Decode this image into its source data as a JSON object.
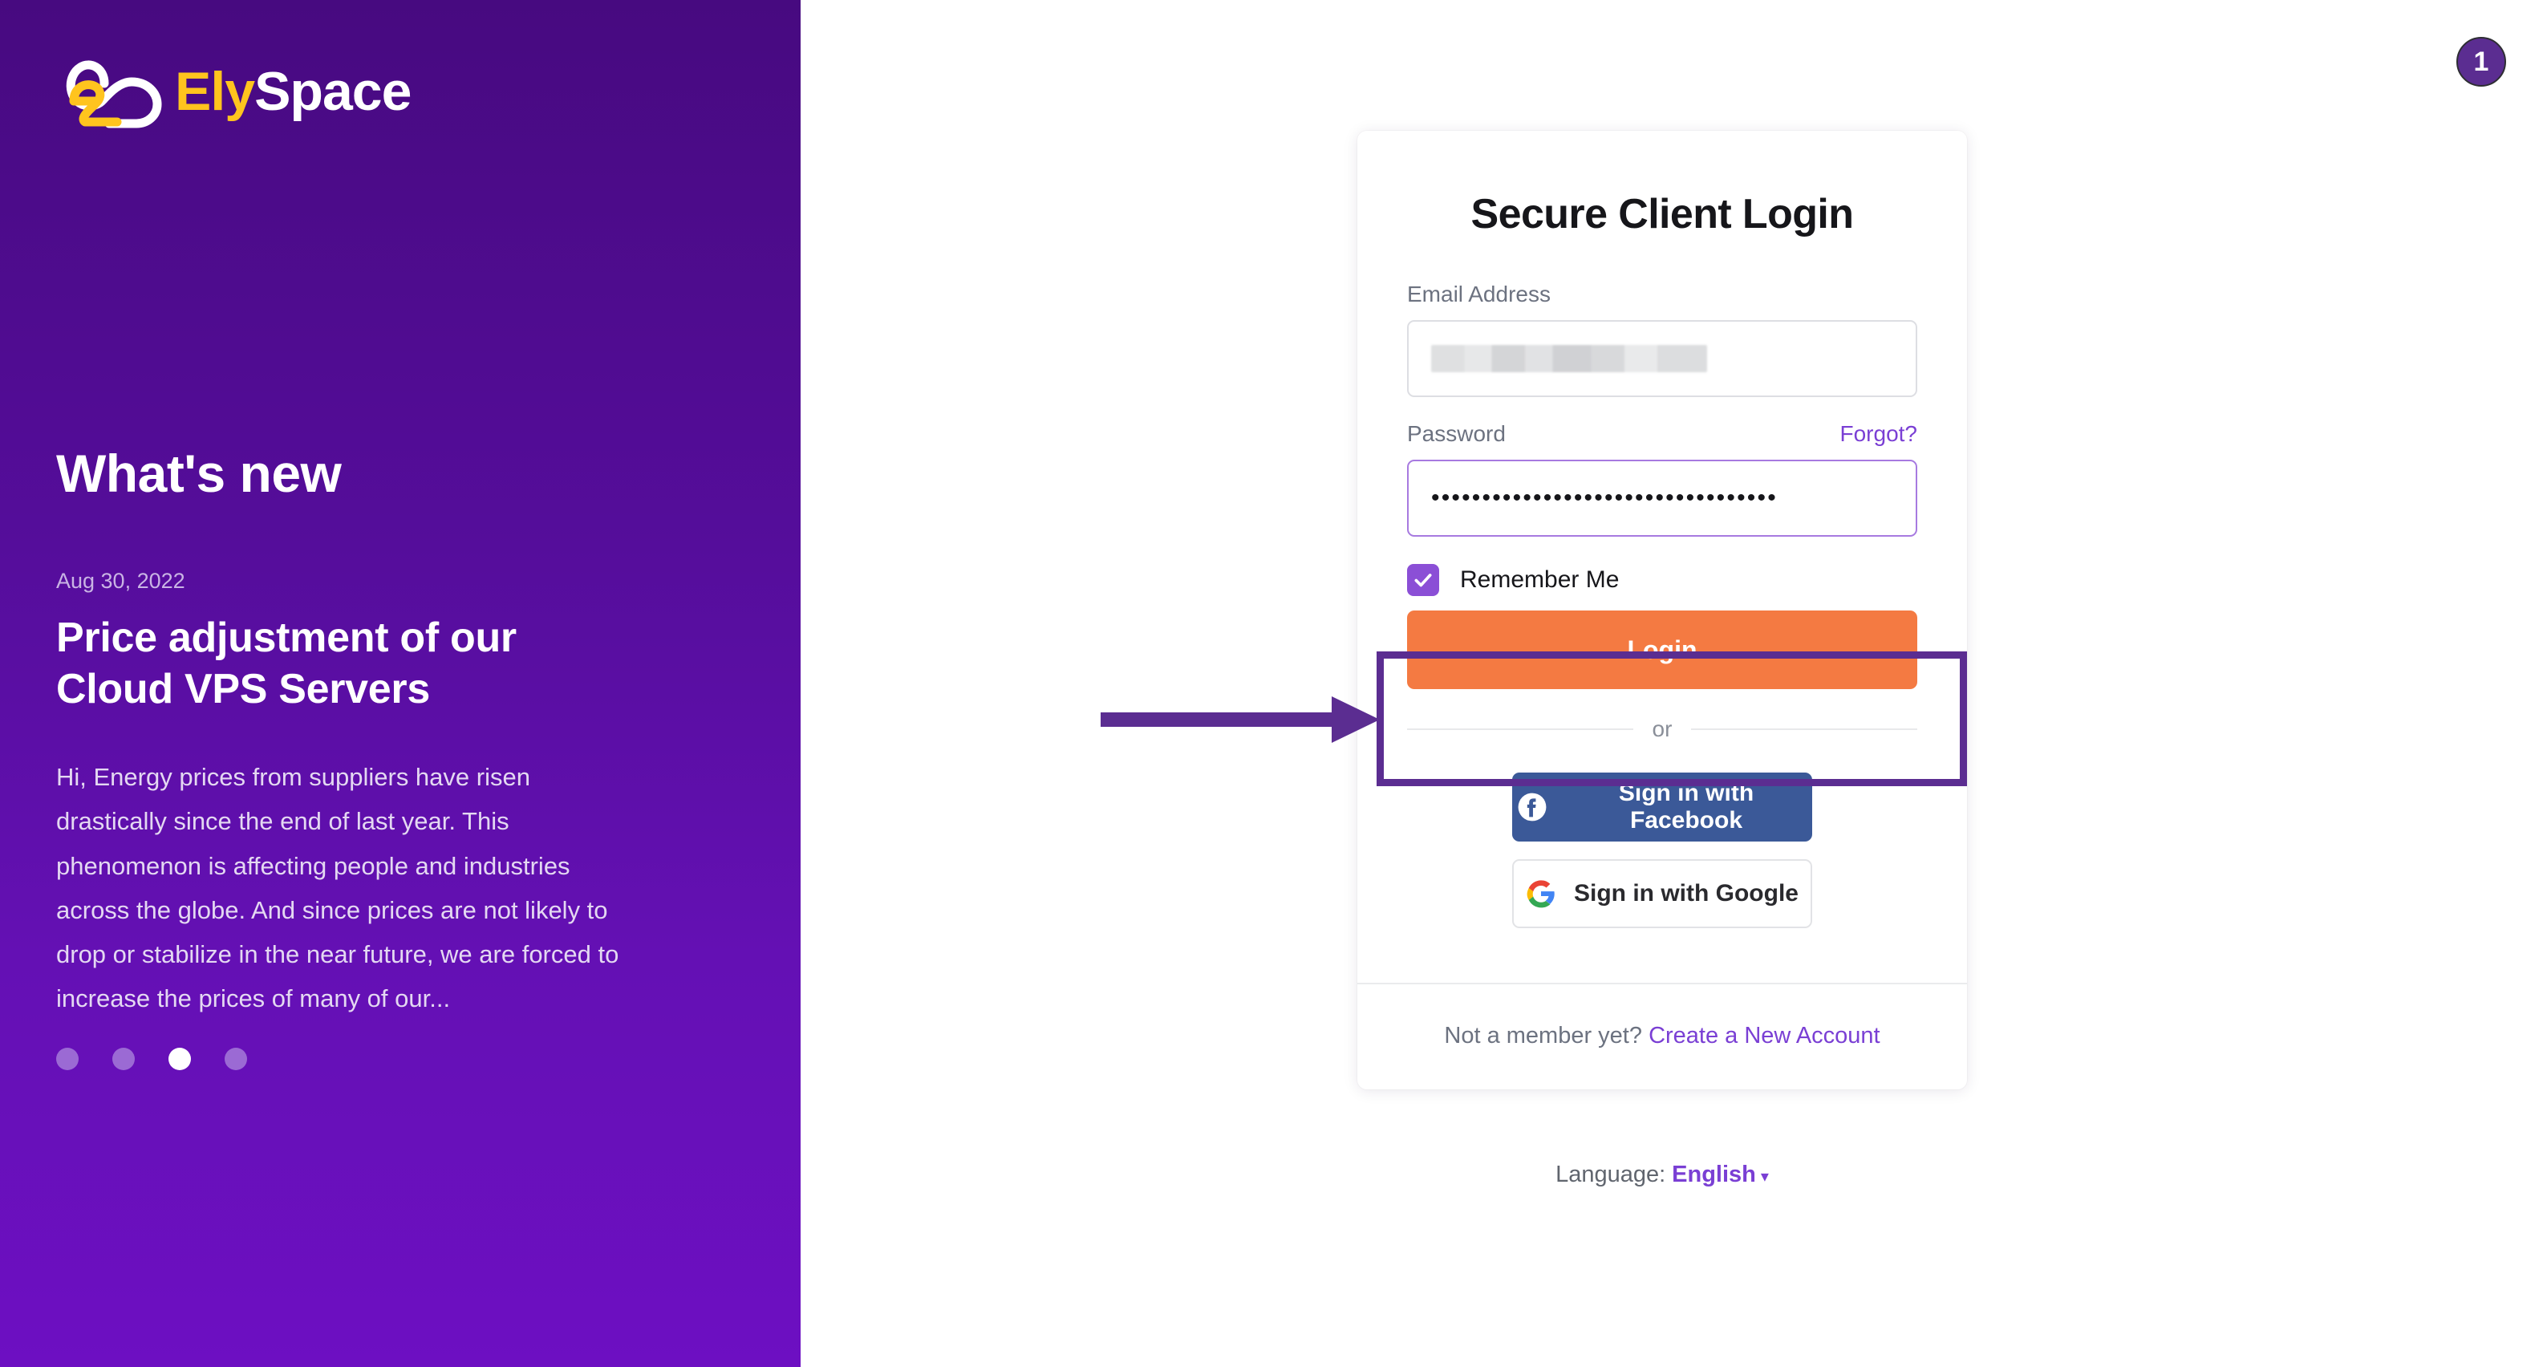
{
  "brand": {
    "name_first": "Ely",
    "name_second": "Space",
    "logo_colors": {
      "yellow": "#FFC41E",
      "white": "#FFFFFF"
    }
  },
  "promo": {
    "heading": "What's new",
    "date": "Aug 30, 2022",
    "title": "Price adjustment of our Cloud VPS Servers",
    "body": "Hi, Energy prices from suppliers have risen drastically since the end of last year. This phenomenon is affecting people and industries across the globe. And since prices are not likely to drop or stabilize in the near future, we are forced to increase the prices of many of our...",
    "carousel": {
      "total": 4,
      "active_index": 2
    }
  },
  "login": {
    "title": "Secure Client Login",
    "email": {
      "label": "Email Address",
      "value": "",
      "placeholder": "",
      "redacted": true
    },
    "password": {
      "label": "Password",
      "forgot_label": "Forgot?",
      "value": "••••••••••••••••••••••••••••••••••",
      "focused": true
    },
    "remember": {
      "label": "Remember Me",
      "checked": true
    },
    "submit_label": "Login",
    "divider_label": "or",
    "social": [
      {
        "label": "Sign in with Facebook",
        "provider": "facebook",
        "color": "#3B5998"
      },
      {
        "label": "Sign in with Google",
        "provider": "google",
        "color": "#FFFFFF"
      }
    ],
    "footer": {
      "prompt": "Not a member yet?",
      "link_label": "Create a New Account"
    }
  },
  "language": {
    "label": "Language:",
    "value": "English",
    "caret": "▾"
  },
  "annotation": {
    "step_number": "1",
    "highlight_color": "#5B2D91",
    "target": "login-button"
  },
  "theme": {
    "panel_top": "#470A80",
    "panel_bottom": "#6D0FC2",
    "accent_purple": "#7A3FD4",
    "primary_orange": "#F47A42"
  }
}
